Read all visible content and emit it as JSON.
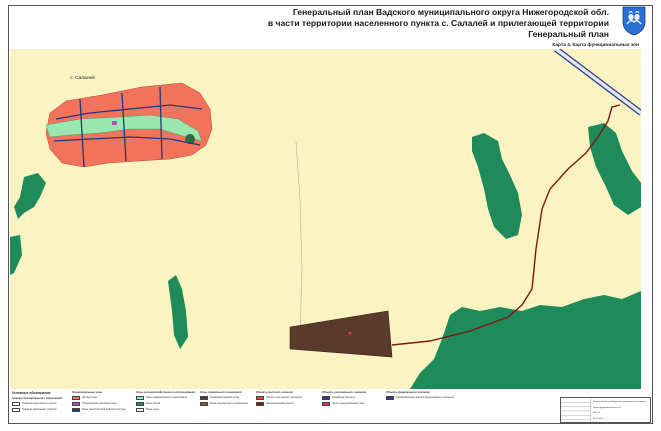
{
  "title_lines": [
    "Генеральный план Вадского муниципального округа Нижегородской обл.",
    "в части территории населенного пункта с. Салалей и прилегающей территории",
    "Генеральный план"
  ],
  "subtitle": "Карта 4. Карта функциональных зон",
  "map_labels": {
    "settlement": "с. Салалей"
  },
  "colors": {
    "background": "#fbf4c2",
    "residential": "#f2735c",
    "forest": "#1f8a5a",
    "green_zone": "#9be7b0",
    "special_zone": "#5a3a2a",
    "road": "#7a1a12",
    "water": "#1e3a80",
    "highway_outline": "#2e3a8c"
  },
  "legend": {
    "heading": "Условные обозначения",
    "groups": [
      {
        "title": "Граница муниципального образования",
        "items": [
          {
            "label": "Граница населенного пункта",
            "color": "#ffffff"
          },
          {
            "label": "Граница земельного участка",
            "color": "#ffffff"
          }
        ]
      },
      {
        "title": "Функциональные зоны",
        "items": [
          {
            "label": "Жилые зоны",
            "color": "#f2735c"
          },
          {
            "label": "Общественно-деловые зоны",
            "color": "#b04fb0"
          },
          {
            "label": "Зона транспортной инфраструктуры",
            "color": "#1e3a80"
          }
        ]
      },
      {
        "title": "Зоны сельскохозяйственного использования",
        "items": [
          {
            "label": "Зоны рекреационного назначения",
            "color": "#9be7b0"
          },
          {
            "label": "Зоны лесов",
            "color": "#1f8a5a"
          },
          {
            "label": "Иные зоны",
            "color": "#fbf4c2"
          }
        ]
      },
      {
        "title": "Зоны специального назначения",
        "items": [
          {
            "label": "Производственная зона",
            "color": "#5a3a2a"
          },
          {
            "label": "Зона специального назначения",
            "color": "#7a5a3a"
          }
        ]
      },
      {
        "title": "Объекты местного значения",
        "items": [
          {
            "label": "Объект культурного наследия",
            "color": "#e04040"
          },
          {
            "label": "Автомобильная дорога",
            "color": "#7a1a12"
          }
        ]
      },
      {
        "title": "Объекты регионального значения",
        "items": [
          {
            "label": "Линейные объекты",
            "color": "#3a3a8c"
          },
          {
            "label": "Пункт редуцирования газа",
            "color": "#d04040"
          }
        ]
      },
      {
        "title": "Объекты федерального значения",
        "items": [
          {
            "label": "Автомобильная дорога федерального значения",
            "color": "#2e3a8c"
          }
        ]
      }
    ]
  },
  "stamp": {
    "rows": [
      "Генеральный план Вадского муниципального округа",
      "Карта функциональных зон",
      "Лист 4",
      "М 1:10000"
    ]
  }
}
